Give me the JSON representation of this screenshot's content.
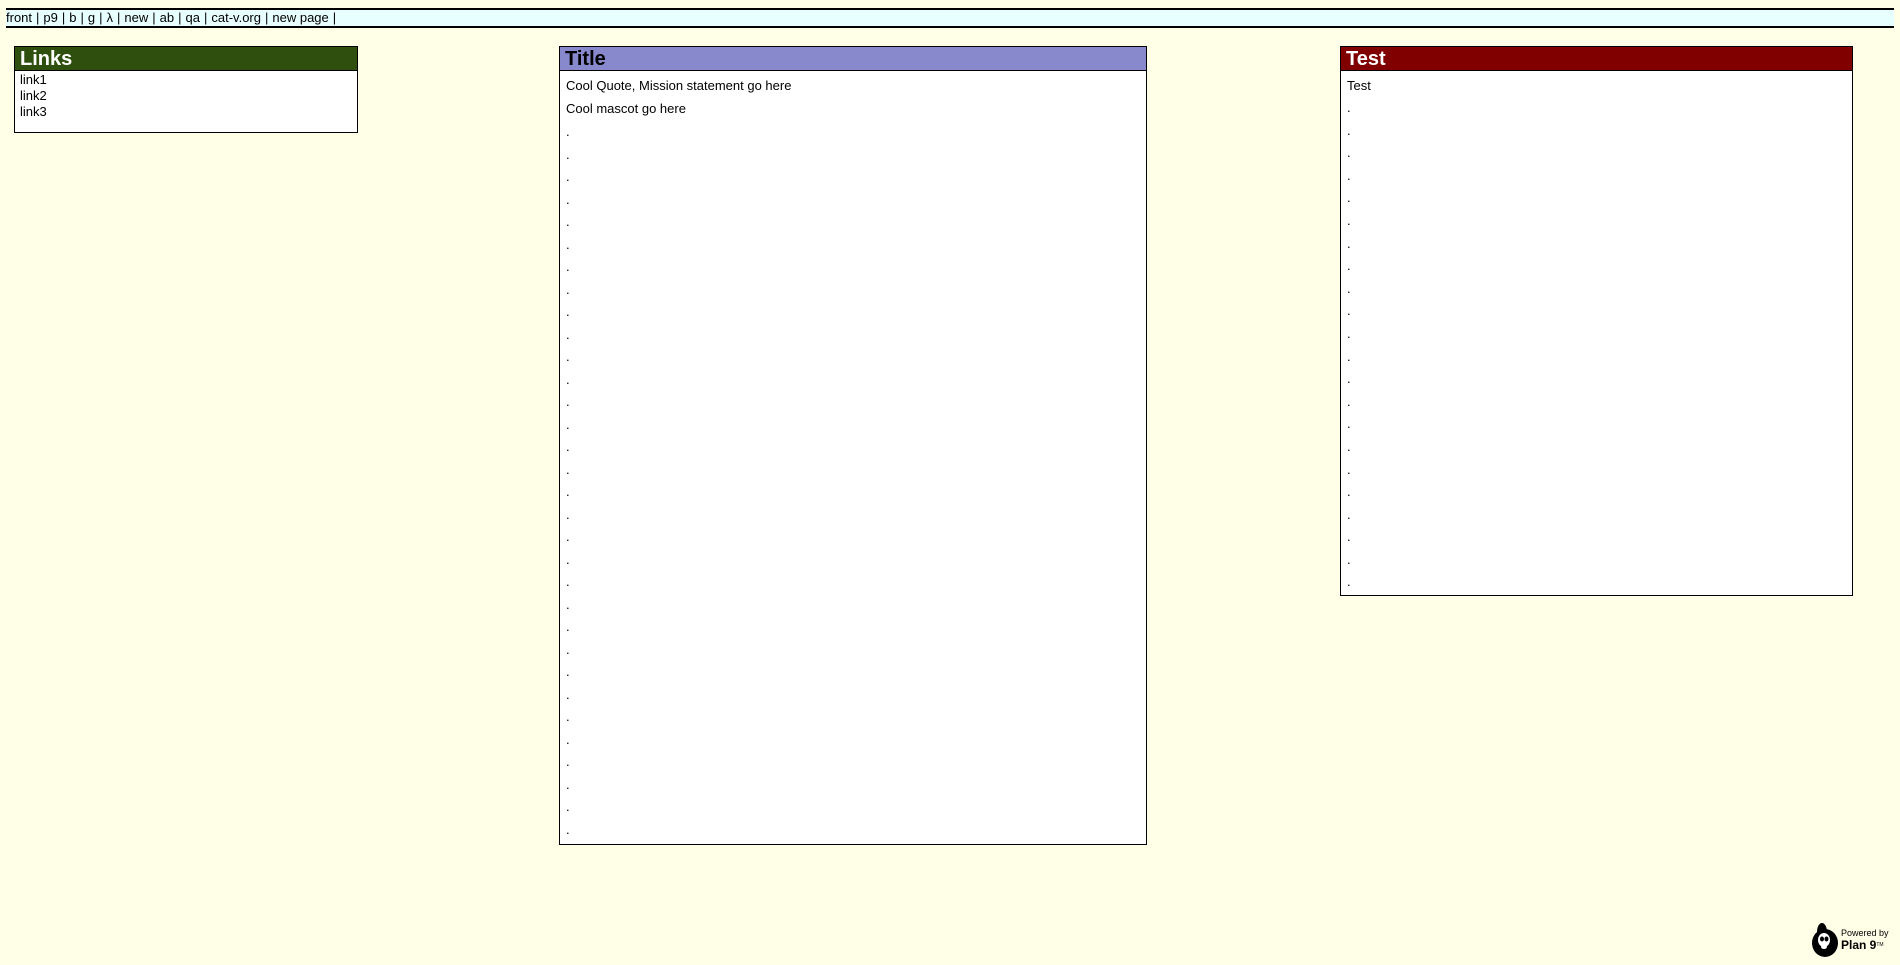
{
  "nav": {
    "links": [
      "front",
      "p9",
      "b",
      "g",
      "λ",
      "new",
      "ab",
      "qa",
      "cat-v.org",
      "new page"
    ],
    "separator": "|"
  },
  "links_box": {
    "title": "Links",
    "items": [
      "link1",
      "link2",
      "link3"
    ]
  },
  "title_box": {
    "title": "Title",
    "paragraphs": [
      "Cool Quote, Mission statement go here",
      "Cool mascot go here"
    ],
    "dot": ".",
    "dot_count": 32
  },
  "test_box": {
    "title": "Test",
    "paragraphs": [
      "Test"
    ],
    "dot": ".",
    "dot_count": 22
  },
  "badge": {
    "powered_by": "Powered by",
    "name": "Plan 9",
    "tm": "TM",
    "icon": "glenda-bunny-icon"
  },
  "colors": {
    "background": "#ffffe8",
    "nav_background": "#e8ffff",
    "links_header": "#2f4f0f",
    "title_header": "#8888cc",
    "test_header": "#800000"
  }
}
